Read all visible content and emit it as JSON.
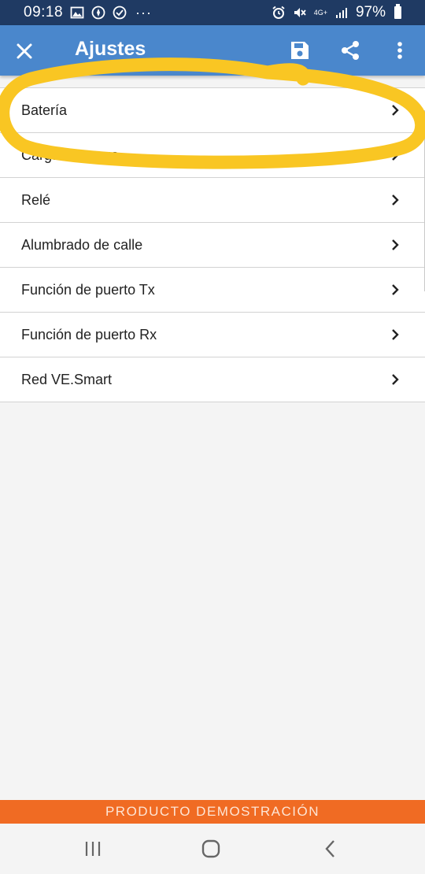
{
  "status_bar": {
    "time": "09:18",
    "overflow": "···",
    "network": "4G+",
    "battery": "97%",
    "icons": [
      "gallery-icon",
      "compass-icon",
      "check-icon",
      "alarm-icon",
      "mute-icon",
      "signal-icon",
      "battery-icon"
    ]
  },
  "app_bar": {
    "title": "Ajustes",
    "close_icon": "close-icon",
    "actions": [
      "save-icon",
      "share-icon",
      "more-vert-icon"
    ],
    "color": "#4a87cc"
  },
  "settings": {
    "items": [
      {
        "label": "Batería"
      },
      {
        "label": "Carga de carga"
      },
      {
        "label": "Relé"
      },
      {
        "label": "Alumbrado de calle"
      },
      {
        "label": "Función de puerto Tx"
      },
      {
        "label": "Función de puerto Rx"
      },
      {
        "label": "Red VE.Smart"
      }
    ]
  },
  "annotation": {
    "color": "#f9c623",
    "shape": "hand-drawn ellipse around first item"
  },
  "demo_banner": {
    "text": "PRODUCTO DEMOSTRACIÓN",
    "color": "#f06b23"
  },
  "nav_bar": {
    "buttons": [
      "recents-icon",
      "home-icon",
      "back-icon"
    ]
  }
}
